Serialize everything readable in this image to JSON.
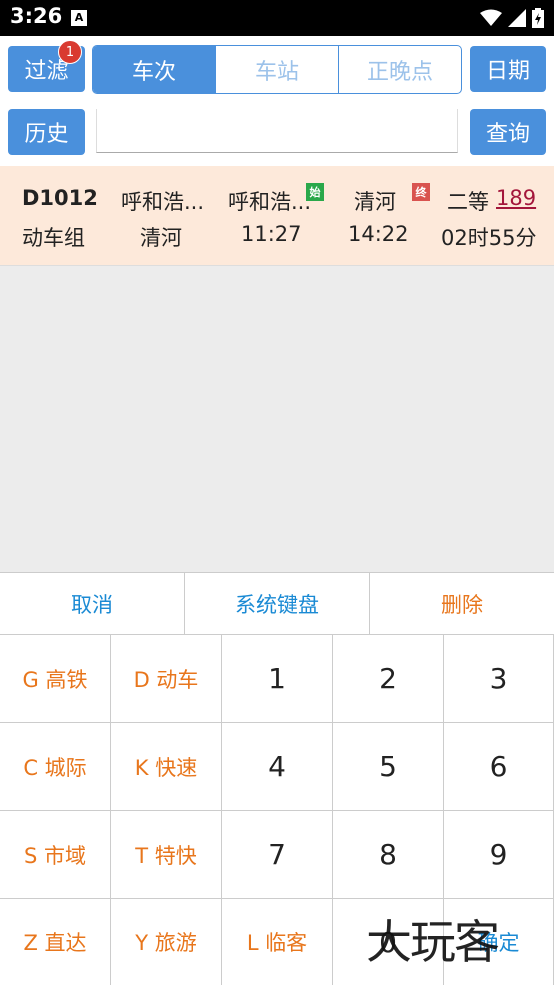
{
  "status_bar": {
    "time": "3:26",
    "notification_letter": "A"
  },
  "filter": {
    "label": "过滤",
    "badge": "1"
  },
  "tabs": [
    "车次",
    "车站",
    "正晚点"
  ],
  "date_button": "日期",
  "history_button": "历史",
  "search_input": {
    "value": "",
    "placeholder": ""
  },
  "query_button": "查询",
  "result": {
    "train_no": "D1012",
    "train_type": "动车组",
    "from_station": "呼和浩...",
    "to_station": "清河",
    "depart_station": "呼和浩...",
    "depart_time": "11:27",
    "start_flag": "始",
    "arrive_station": "清河",
    "arrive_time": "14:22",
    "end_flag": "终",
    "seat_class": "二等",
    "price": "189",
    "duration": "02时55分"
  },
  "keyboard": {
    "cancel": "取消",
    "system_keyboard": "系统键盘",
    "delete": "删除",
    "type_keys": [
      "G 高铁",
      "D 动车",
      "C 城际",
      "K 快速",
      "S 市域",
      "T 特快",
      "Z 直达",
      "Y 旅游",
      "L 临客"
    ],
    "digits": [
      "1",
      "2",
      "3",
      "4",
      "5",
      "6",
      "7",
      "8",
      "9",
      "0"
    ],
    "confirm": "确定"
  },
  "watermark": "大玩客",
  "colors": {
    "accent": "#4a90dc",
    "badge": "#d93a30",
    "row_bg": "#fde9da",
    "orange": "#e8761c",
    "link_blue": "#1a8ad4",
    "price": "#a3163b"
  }
}
